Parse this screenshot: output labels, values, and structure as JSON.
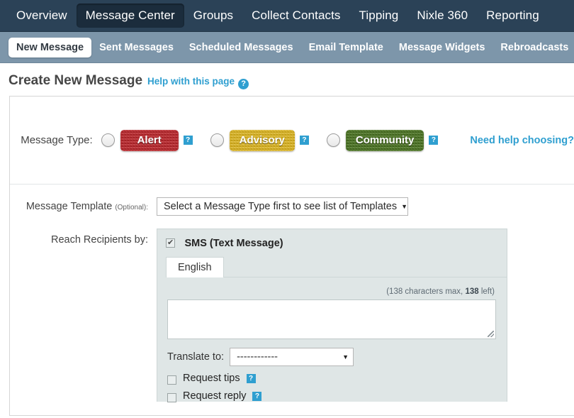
{
  "topnav": {
    "items": [
      {
        "label": "Overview",
        "active": false
      },
      {
        "label": "Message Center",
        "active": true
      },
      {
        "label": "Groups",
        "active": false
      },
      {
        "label": "Collect Contacts",
        "active": false
      },
      {
        "label": "Tipping",
        "active": false
      },
      {
        "label": "Nixle 360",
        "active": false
      },
      {
        "label": "Reporting",
        "active": false
      }
    ]
  },
  "subnav": {
    "items": [
      {
        "label": "New Message",
        "active": true
      },
      {
        "label": "Sent Messages",
        "active": false
      },
      {
        "label": "Scheduled Messages",
        "active": false
      },
      {
        "label": "Email Template",
        "active": false
      },
      {
        "label": "Message Widgets",
        "active": false
      },
      {
        "label": "Rebroadcasts",
        "active": false
      }
    ]
  },
  "page": {
    "title": "Create New Message",
    "help_link": "Help with this page",
    "help_icon_glyph": "?"
  },
  "message_type": {
    "label": "Message Type:",
    "options": [
      {
        "label": "Alert",
        "color": "#c2161c",
        "help_glyph": "?"
      },
      {
        "label": "Advisory",
        "color": "#e3b406",
        "help_glyph": "?"
      },
      {
        "label": "Community",
        "color": "#3f6f10",
        "help_glyph": "?"
      }
    ],
    "need_help_link": "Need help choosing?"
  },
  "message_template": {
    "label": "Message Template",
    "optional": "(Optional):",
    "selected": "Select a Message Type first to see list of Templates",
    "caret": "▼"
  },
  "reach_recipients": {
    "label": "Reach Recipients by:",
    "sms": {
      "checkbox_label": "SMS (Text Message)",
      "checked": true,
      "language_tabs": [
        {
          "label": "English",
          "active": true
        }
      ],
      "char_count_prefix": "(138 characters max, ",
      "char_count_value": "138",
      "char_count_suffix": " left)",
      "textarea_value": "",
      "translate_label": "Translate to:",
      "translate_selected": "------------",
      "caret": "▼",
      "request_tips": {
        "label": "Request tips",
        "checked": false,
        "help_glyph": "?"
      },
      "request_reply": {
        "label": "Request reply",
        "checked": false,
        "help_glyph": "?"
      }
    }
  },
  "colors": {
    "topnav_bg": "#2b4257",
    "subnav_bg": "#7d96aa",
    "link_blue": "#2f9fd0",
    "panel_bg": "#dfe6e6"
  }
}
